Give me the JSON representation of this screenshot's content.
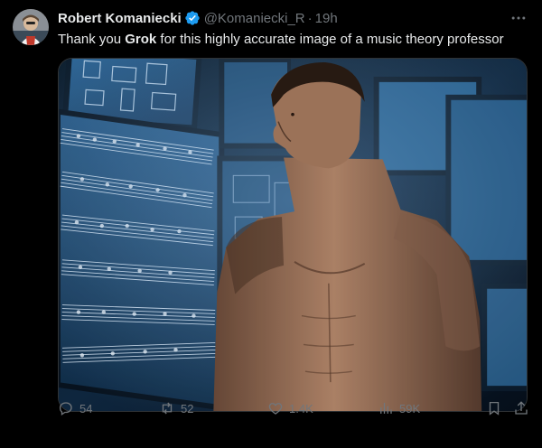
{
  "tweet": {
    "author": {
      "display_name": "Robert Komaniecki",
      "verified": true,
      "handle": "@Komaniecki_R",
      "separator": "·",
      "time": "19h"
    },
    "text_before": "Thank you ",
    "text_bold": "Grok",
    "text_after": " for this highly accurate image of a music theory professor",
    "stats": {
      "replies": "54",
      "reposts": "52",
      "likes": "1.4K",
      "views": "59K"
    }
  },
  "icons": {
    "more": "more-icon",
    "reply": "reply-icon",
    "repost": "repost-icon",
    "like": "heart-icon",
    "views": "views-icon",
    "bookmark": "bookmark-icon",
    "share": "share-icon",
    "verified": "verified-badge-icon"
  },
  "colors": {
    "background": "#000000",
    "text": "#e7e9ea",
    "secondary": "#71767b",
    "verified": "#1d9bf0",
    "border": "#2f3336"
  }
}
